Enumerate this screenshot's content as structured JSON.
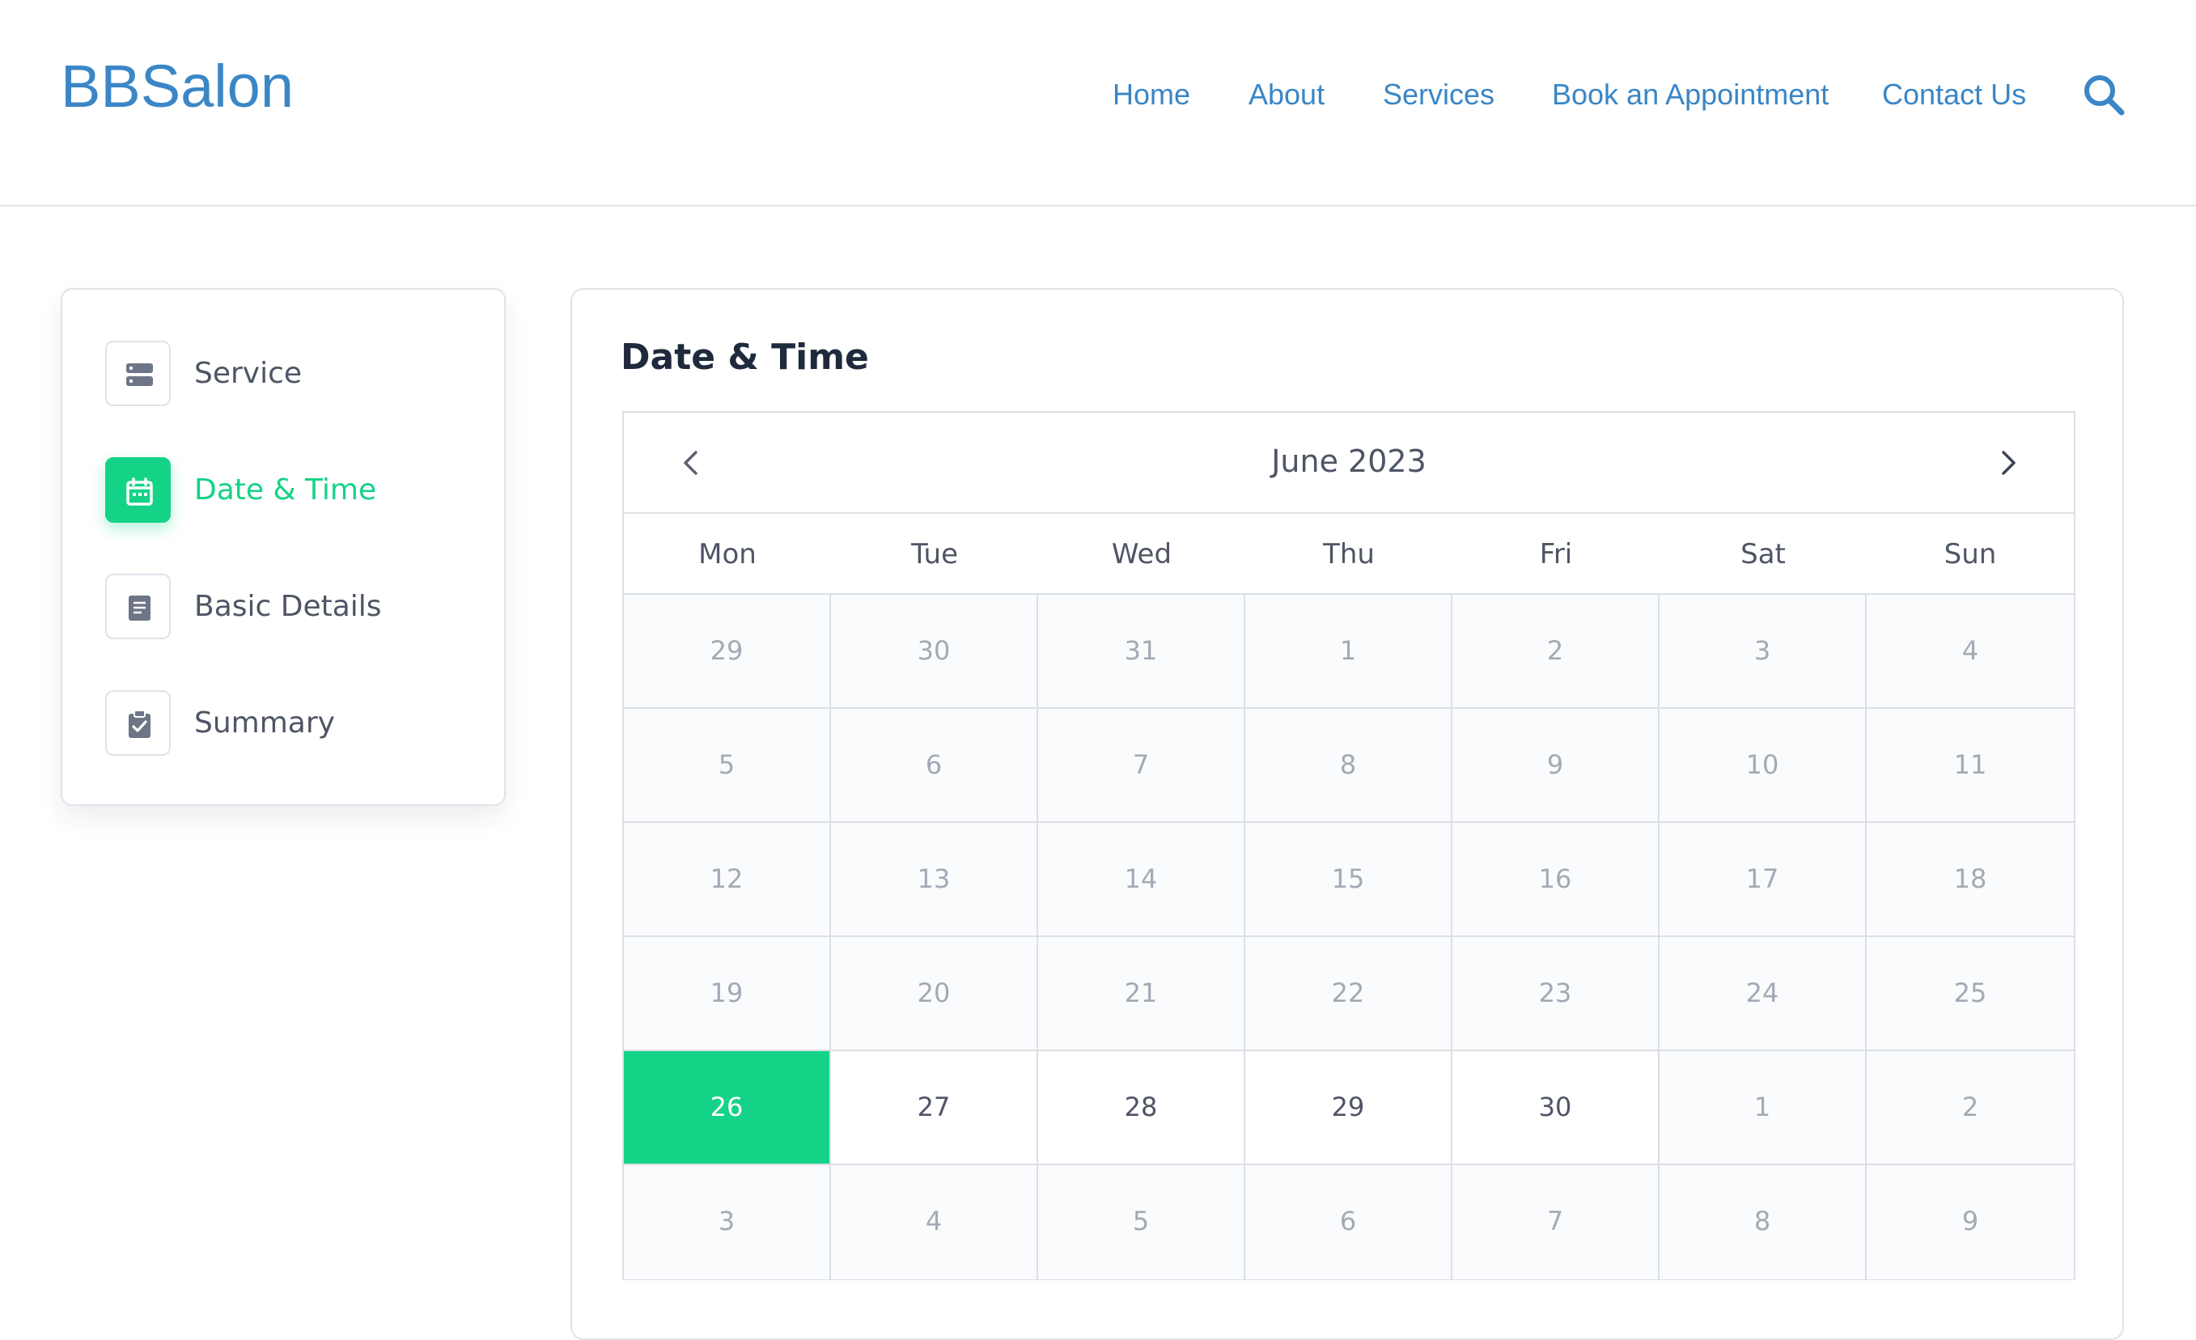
{
  "header": {
    "logo": "BBSalon",
    "nav": [
      {
        "label": "Home",
        "name": "nav-home"
      },
      {
        "label": "About",
        "name": "nav-about"
      },
      {
        "label": "Services",
        "name": "nav-services"
      },
      {
        "label": "Book an Appointment",
        "name": "nav-book-appointment"
      },
      {
        "label": "Contact Us",
        "name": "nav-contact-us"
      }
    ],
    "search_icon": "search-icon"
  },
  "steps": [
    {
      "label": "Service",
      "icon": "server-icon",
      "active": false
    },
    {
      "label": "Date & Time",
      "icon": "calendar-icon",
      "active": true
    },
    {
      "label": "Basic Details",
      "icon": "document-icon",
      "active": false
    },
    {
      "label": "Summary",
      "icon": "clipboard-check-icon",
      "active": false
    }
  ],
  "panel": {
    "title": "Date & Time"
  },
  "calendar": {
    "month_label": "June 2023",
    "prev_icon": "chevron-left-icon",
    "next_icon": "chevron-right-icon",
    "weekdays": [
      "Mon",
      "Tue",
      "Wed",
      "Thu",
      "Fri",
      "Sat",
      "Sun"
    ],
    "selected": "26",
    "weeks": [
      [
        {
          "day": "29",
          "muted": true
        },
        {
          "day": "30",
          "muted": true
        },
        {
          "day": "31",
          "muted": true
        },
        {
          "day": "1",
          "muted": true
        },
        {
          "day": "2",
          "muted": true
        },
        {
          "day": "3",
          "muted": true
        },
        {
          "day": "4",
          "muted": true
        }
      ],
      [
        {
          "day": "5",
          "muted": true
        },
        {
          "day": "6",
          "muted": true
        },
        {
          "day": "7",
          "muted": true
        },
        {
          "day": "8",
          "muted": true
        },
        {
          "day": "9",
          "muted": true
        },
        {
          "day": "10",
          "muted": true
        },
        {
          "day": "11",
          "muted": true
        }
      ],
      [
        {
          "day": "12",
          "muted": true
        },
        {
          "day": "13",
          "muted": true
        },
        {
          "day": "14",
          "muted": true
        },
        {
          "day": "15",
          "muted": true
        },
        {
          "day": "16",
          "muted": true
        },
        {
          "day": "17",
          "muted": true
        },
        {
          "day": "18",
          "muted": true
        }
      ],
      [
        {
          "day": "19",
          "muted": true
        },
        {
          "day": "20",
          "muted": true
        },
        {
          "day": "21",
          "muted": true
        },
        {
          "day": "22",
          "muted": true
        },
        {
          "day": "23",
          "muted": true
        },
        {
          "day": "24",
          "muted": true
        },
        {
          "day": "25",
          "muted": true
        }
      ],
      [
        {
          "day": "26",
          "muted": false,
          "selected": true
        },
        {
          "day": "27",
          "muted": false
        },
        {
          "day": "28",
          "muted": false
        },
        {
          "day": "29",
          "muted": false
        },
        {
          "day": "30",
          "muted": false
        },
        {
          "day": "1",
          "muted": true
        },
        {
          "day": "2",
          "muted": true
        }
      ],
      [
        {
          "day": "3",
          "muted": true
        },
        {
          "day": "4",
          "muted": true
        },
        {
          "day": "5",
          "muted": true
        },
        {
          "day": "6",
          "muted": true
        },
        {
          "day": "7",
          "muted": true
        },
        {
          "day": "8",
          "muted": true
        },
        {
          "day": "9",
          "muted": true
        }
      ]
    ]
  },
  "colors": {
    "brand": "#3a86c6",
    "accent": "#14d386",
    "text": "#4e5565",
    "muted_text": "#a3a9b5",
    "border": "#dcdfe6"
  }
}
